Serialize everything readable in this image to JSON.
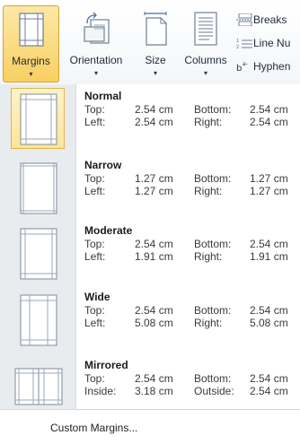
{
  "ribbon": {
    "margins_label": "Margins",
    "orientation_label": "Orientation",
    "size_label": "Size",
    "columns_label": "Columns",
    "breaks_label": "Breaks",
    "line_numbers_label": "Line Nu",
    "hyphenation_label": "Hyphen",
    "dropdown_arrow": "▾",
    "active_color": "#f8cf62"
  },
  "margins": [
    {
      "name": "Normal",
      "l1": "Top:",
      "v1": "2.54 cm",
      "l2": "Bottom:",
      "v2": "2.54 cm",
      "l3": "Left:",
      "v3": "2.54 cm",
      "l4": "Right:",
      "v4": "2.54 cm"
    },
    {
      "name": "Narrow",
      "l1": "Top:",
      "v1": "1.27 cm",
      "l2": "Bottom:",
      "v2": "1.27 cm",
      "l3": "Left:",
      "v3": "1.27 cm",
      "l4": "Right:",
      "v4": "1.27 cm"
    },
    {
      "name": "Moderate",
      "l1": "Top:",
      "v1": "2.54 cm",
      "l2": "Bottom:",
      "v2": "2.54 cm",
      "l3": "Left:",
      "v3": "1.91 cm",
      "l4": "Right:",
      "v4": "1.91 cm"
    },
    {
      "name": "Wide",
      "l1": "Top:",
      "v1": "2.54 cm",
      "l2": "Bottom:",
      "v2": "2.54 cm",
      "l3": "Left:",
      "v3": "5.08 cm",
      "l4": "Right:",
      "v4": "5.08 cm"
    },
    {
      "name": "Mirrored",
      "l1": "Top:",
      "v1": "2.54 cm",
      "l2": "Bottom:",
      "v2": "2.54 cm",
      "l3": "Inside:",
      "v3": "3.18 cm",
      "l4": "Outside:",
      "v4": "2.54 cm"
    }
  ],
  "custom_margins_label": "Custom Margins..."
}
